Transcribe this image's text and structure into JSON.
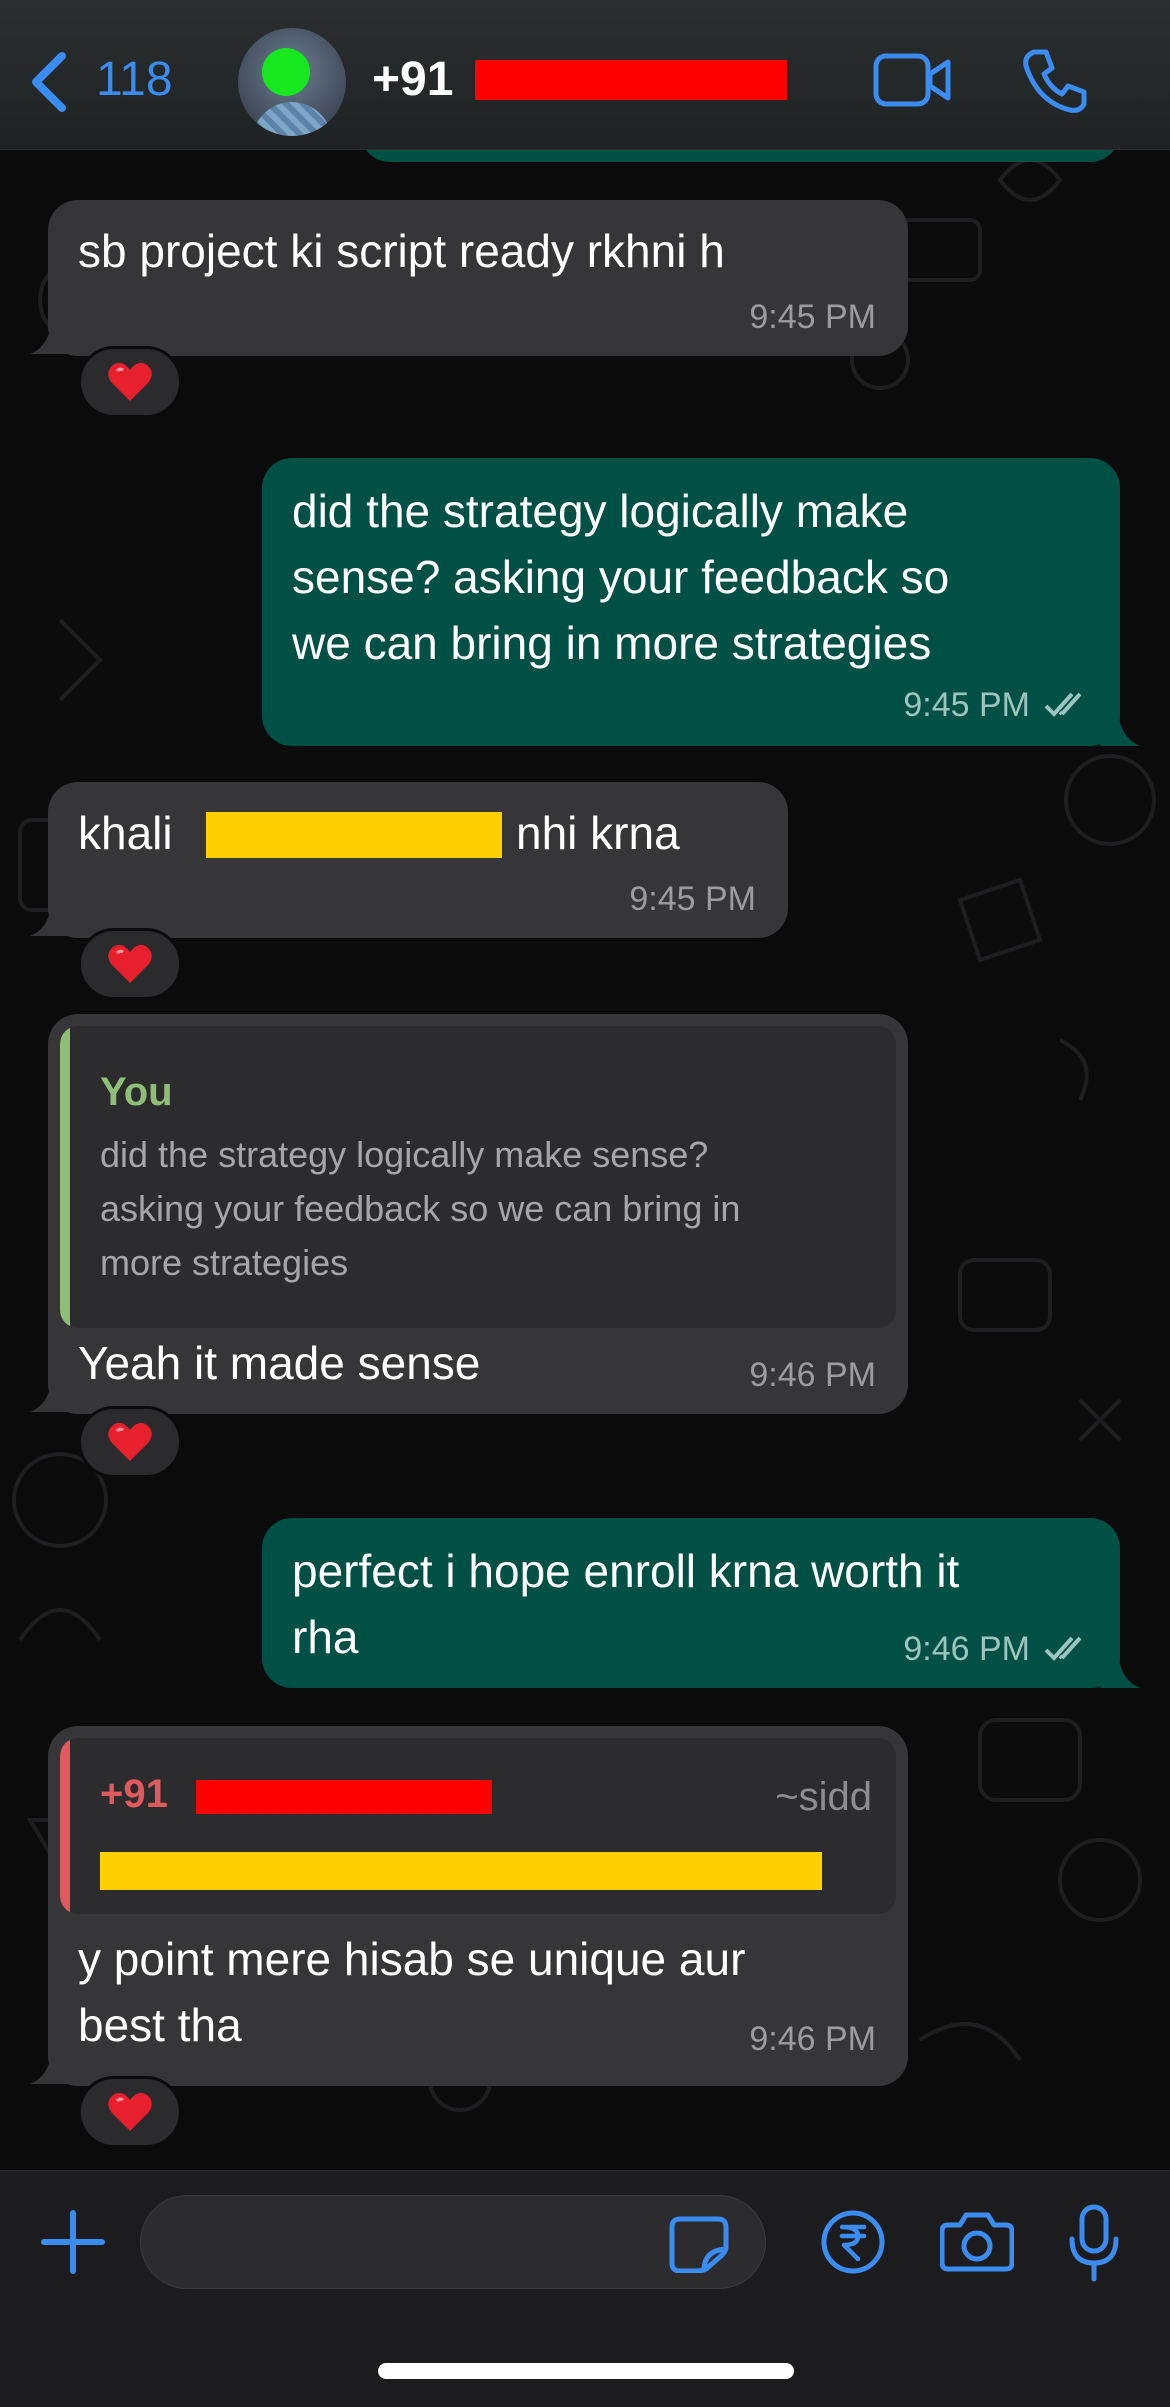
{
  "header": {
    "back_count": "118",
    "contact_prefix": "+91",
    "icons": {
      "back": "chevron-left-icon",
      "video": "video-camera-icon",
      "call": "phone-icon"
    },
    "accent_color": "#3b8cf0"
  },
  "messages": [
    {
      "direction": "incoming",
      "text": "sb project ki script ready rkhni h",
      "time": "9:45 PM",
      "reaction": "❤️"
    },
    {
      "direction": "outgoing",
      "text": "did the strategy logically make\nsense? asking your feedback so\nwe can bring in more strategies",
      "time": "9:45 PM",
      "status": "read"
    },
    {
      "direction": "incoming",
      "text_before": "khali",
      "text_after": "nhi krna",
      "time": "9:45 PM",
      "reaction": "❤️"
    },
    {
      "direction": "incoming",
      "quote": {
        "author": "You",
        "text": "did the strategy logically make sense?\nasking your feedback so we can bring in\nmore strategies"
      },
      "text": "Yeah it made sense",
      "time": "9:46 PM",
      "reaction": "❤️"
    },
    {
      "direction": "outgoing",
      "text": "perfect i hope enroll krna worth it\nrha",
      "time": "9:46 PM",
      "status": "read"
    },
    {
      "direction": "incoming",
      "quote": {
        "author_prefix": "+91",
        "author_alias": "~sidd"
      },
      "text": "y point mere hisab se unique aur\nbest tha",
      "time": "9:46 PM",
      "reaction": "❤️"
    }
  ],
  "composer": {
    "value": "",
    "icons": {
      "attach": "plus-icon",
      "sticker": "sticker-icon",
      "payment": "rupee-icon",
      "camera": "camera-icon",
      "voice": "microphone-icon"
    }
  },
  "colors": {
    "incoming_bubble": "#363638",
    "outgoing_bubble": "#005046",
    "quote_you": "#8fbf77",
    "quote_other": "#e0595c",
    "redaction_red": "#ff0000",
    "redaction_yellow": "#ffd000"
  }
}
